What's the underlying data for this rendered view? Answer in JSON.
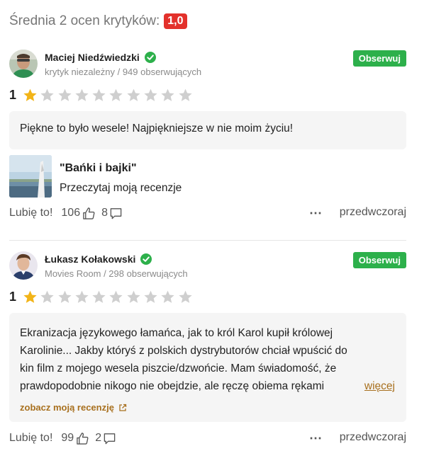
{
  "header": {
    "label": "Średnia 2 ocen krytyków:",
    "score": "1,0",
    "score_color": "#e3312b"
  },
  "colors": {
    "accent_green": "#2db04b",
    "star_filled": "#f2b418",
    "star_empty": "#cfcfcf",
    "link_brown": "#a8701e"
  },
  "reviews": [
    {
      "author": "Maciej Niedźwiedzki",
      "meta": "krytyk niezależny / 949 obserwujących",
      "follow_label": "Obserwuj",
      "rating": "1",
      "rating_value": 1,
      "rating_max": 10,
      "quote": "Piękne to było wesele! Najpiękniejsze w nie moim życiu!",
      "linked_review": {
        "title": "\"Bańki i bajki\"",
        "cta": "Przeczytaj moją recenzje"
      },
      "like_label": "Lubię to!",
      "likes": "106",
      "comments": "8",
      "more_icon": "⋯",
      "date": "przedwczoraj"
    },
    {
      "author": "Łukasz Kołakowski",
      "meta": "Movies Room / 298 obserwujących",
      "follow_label": "Obserwuj",
      "rating": "1",
      "rating_value": 1,
      "rating_max": 10,
      "quote_lines": [
        "Ekranizacja językowego łamańca, jak to król Karol kupił królowej",
        "Karolinie... Jakby któryś z polskich dystrybutorów chciał wpuścić do",
        "kin film z mojego wesela piszcie/dzwońcie. Mam świadomość, że",
        "prawdopodobnie nikogo nie obejdzie, ale ręczę obiema rękami"
      ],
      "more_label": "więcej",
      "see_review_label": "zobacz moją recenzję",
      "like_label": "Lubię to!",
      "likes": "99",
      "comments": "2",
      "more_icon": "⋯",
      "date": "przedwczoraj"
    }
  ]
}
